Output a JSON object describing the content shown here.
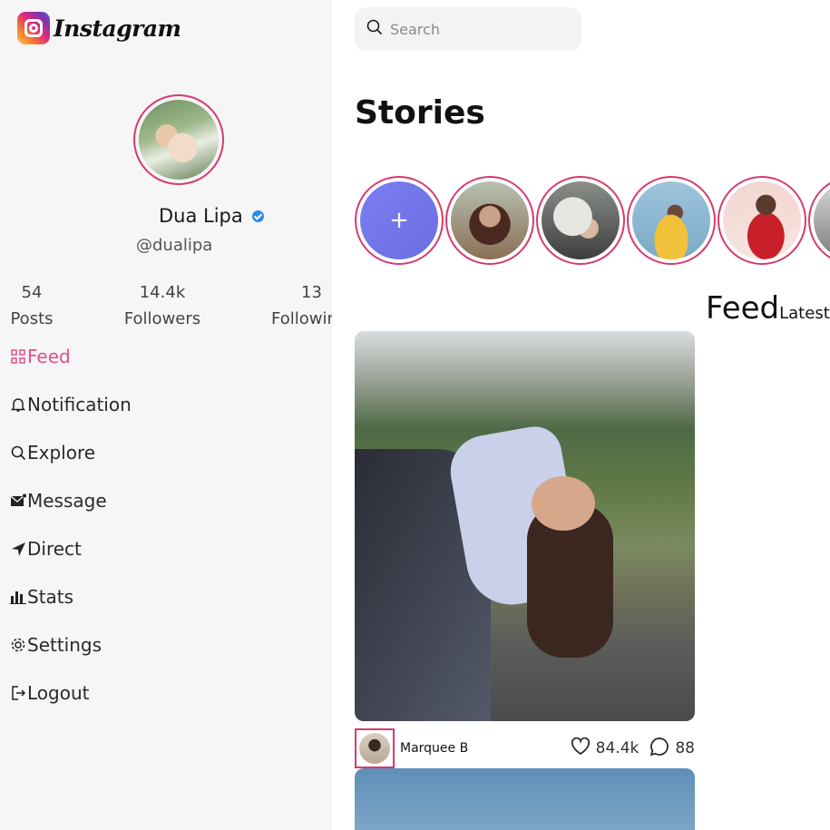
{
  "app": {
    "logo_text": "Instagram"
  },
  "profile": {
    "name": "Dua Lipa",
    "handle": "@dualipa"
  },
  "stats": [
    {
      "value": "54",
      "label": "Posts"
    },
    {
      "value": "14.4k",
      "label": "Followers"
    },
    {
      "value": "13",
      "label": "Following"
    }
  ],
  "nav": [
    {
      "label": "Feed",
      "icon": "grid-icon",
      "active": true
    },
    {
      "label": "Notification",
      "icon": "bell-icon"
    },
    {
      "label": "Explore",
      "icon": "search-icon"
    },
    {
      "label": "Message",
      "icon": "envelope-icon"
    },
    {
      "label": "Direct",
      "icon": "send-icon"
    },
    {
      "label": "Stats",
      "icon": "bar-chart-icon"
    },
    {
      "label": "Settings",
      "icon": "gear-icon"
    },
    {
      "label": "Logout",
      "icon": "logout-icon"
    }
  ],
  "search": {
    "placeholder": "Search"
  },
  "stories": {
    "title": "Stories",
    "add_symbol": "+"
  },
  "feed": {
    "title": "Feed",
    "subtitle": "Latest"
  },
  "post": {
    "author": "Marquee B",
    "likes": "84.4k",
    "comments": "88"
  },
  "colors": {
    "accent": "#e0508a",
    "ring": "#d63a6f",
    "verified": "#2d8ae8"
  }
}
